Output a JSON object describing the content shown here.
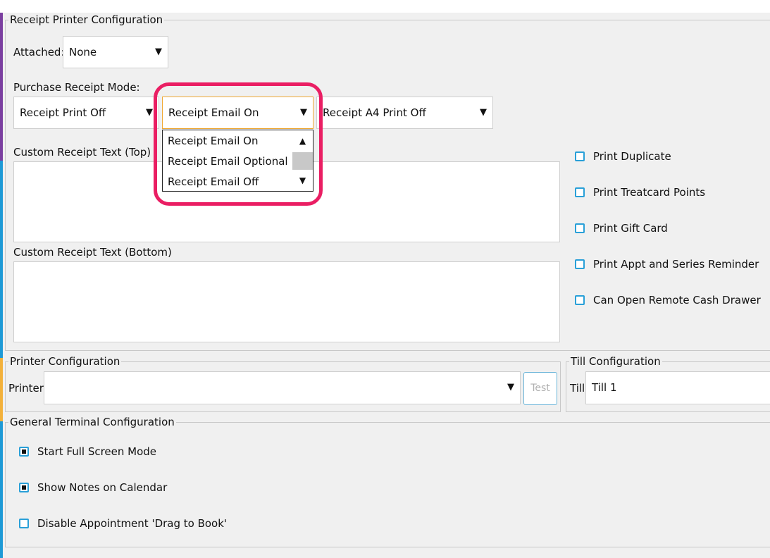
{
  "receipt": {
    "legend": "Receipt Printer Configuration",
    "attached_label": "Attached:",
    "attached_value": "None",
    "mode_label": "Purchase Receipt Mode:",
    "print_mode": "Receipt Print Off",
    "email_mode": "Receipt Email On",
    "a4_mode": "Receipt A4 Print Off",
    "email_options": [
      "Receipt Email On",
      "Receipt Email Optional",
      "Receipt Email Off"
    ],
    "custom_top_label": "Custom Receipt Text (Top)",
    "custom_bottom_label": "Custom Receipt Text (Bottom)",
    "options": [
      {
        "label": "Print Duplicate",
        "checked": false
      },
      {
        "label": "Print Treatcard Points",
        "checked": false
      },
      {
        "label": "Print Gift Card",
        "checked": false
      },
      {
        "label": "Print Appt and Series Reminder",
        "checked": false
      },
      {
        "label": "Can Open Remote Cash Drawer",
        "checked": false
      }
    ]
  },
  "printer": {
    "legend": "Printer Configuration",
    "label": "Printer",
    "value": "",
    "test_label": "Test"
  },
  "till": {
    "legend": "Till Configuration",
    "label": "Till",
    "value": "Till 1"
  },
  "general": {
    "legend": "General Terminal Configuration",
    "options": [
      {
        "label": "Start Full Screen Mode",
        "checked": true
      },
      {
        "label": "Show Notes on Calendar",
        "checked": true
      },
      {
        "label": "Disable Appointment 'Drag to Book'",
        "checked": false
      }
    ]
  },
  "colors": {
    "highlight": "#ea1e63",
    "checkbox": "#2aa0d8",
    "focus": "#f0a830"
  }
}
